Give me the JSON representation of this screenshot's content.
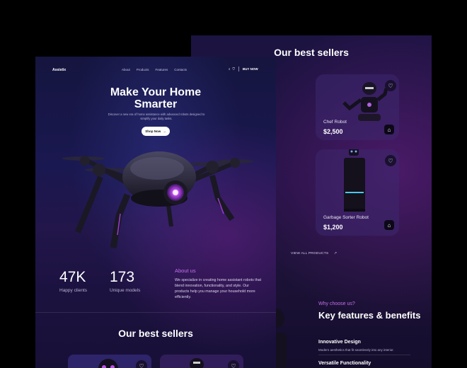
{
  "back_page": {
    "title": "Our best sellers",
    "products": [
      {
        "name": "Chef Robot",
        "price": "$2,500"
      },
      {
        "name": "Garbage Sorter Robot",
        "price": "$1,200"
      }
    ],
    "view_all": "VIEW ALL PRODUCTS",
    "why": "Why choose us?",
    "features_title": "Key features & benefits",
    "features": [
      {
        "title": "Innovative Design",
        "desc": "Modern aesthetics that fit seamlessly into any interior."
      },
      {
        "title": "Versatile Functionality",
        "desc": ""
      }
    ]
  },
  "front_page": {
    "logo": "Assistix",
    "nav": [
      "About",
      "Products",
      "Features",
      "Contacts"
    ],
    "buy_now": "BUY NOW",
    "hero_title_1": "Make Your Home",
    "hero_title_2": "Smarter",
    "hero_sub": "Discover a new era of home assistance with advanced robots designed to simplify your daily tasks.",
    "shop_now": "Shop Now",
    "stats": [
      {
        "value": "47K",
        "label": "Happy clients"
      },
      {
        "value": "173",
        "label": "Unique models"
      }
    ],
    "about_title": "About us",
    "about_text": "We specialize in creating home assistant robots that blend innovation, functionality, and style. Our products help you manage your household more efficiently.",
    "best_sellers": "Our best sellers"
  },
  "colors": {
    "accent": "#c36fe9",
    "bg_front": "#1a1850",
    "bg_back": "#221243"
  },
  "icons": [
    "heart-icon",
    "shopping-bag-icon",
    "search-icon",
    "cart-icon",
    "arrow-right-icon",
    "arrow-up-right-icon"
  ]
}
